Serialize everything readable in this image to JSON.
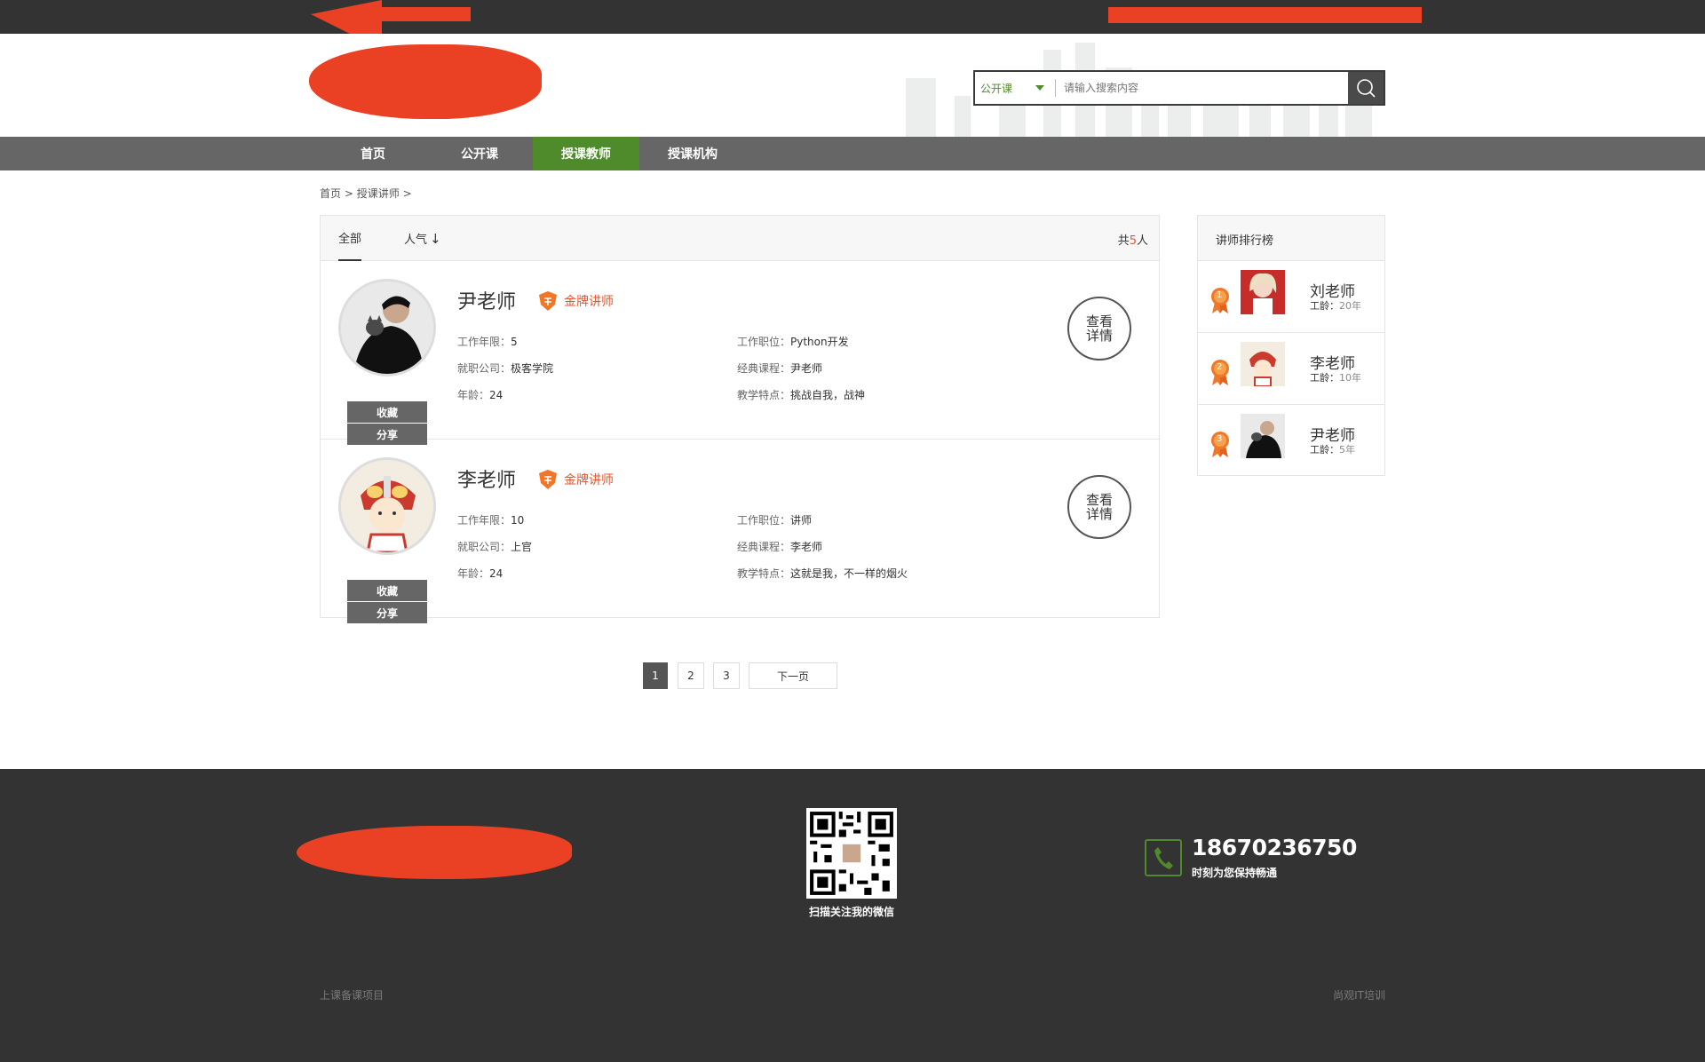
{
  "colors": {
    "accent_green": "#4f8a2b",
    "accent_orange": "#e8532b",
    "nav_bg": "#666666",
    "dark_bg": "#333333"
  },
  "search": {
    "type": "公开课",
    "placeholder": "请输入搜索内容"
  },
  "nav": {
    "items": [
      {
        "label": "首页"
      },
      {
        "label": "公开课"
      },
      {
        "label": "授课教师"
      },
      {
        "label": "授课机构"
      }
    ],
    "active": "授课教师"
  },
  "breadcrumb": {
    "home": "首页",
    "sep": ">",
    "current": "授课讲师"
  },
  "list": {
    "tab_all": "全部",
    "tab_popular": "人气",
    "tab_popular_arrow": "↓",
    "count_prefix": "共",
    "count": "5",
    "count_suffix": "人",
    "teachers": [
      {
        "name": "尹老师",
        "badge": "金牌讲师",
        "years_label": "工作年限：",
        "years": "5",
        "company_label": "就职公司：",
        "company": "极客学院",
        "age_label": "年龄：",
        "age": "24",
        "position_label": "工作职位：",
        "position": "Python开发",
        "course_label": "经典课程：",
        "course": "尹老师",
        "feature_label": "教学特点：",
        "feature": "挑战自我，战神",
        "fav": "收藏",
        "share": "分享",
        "detail": "查看详情"
      },
      {
        "name": "李老师",
        "badge": "金牌讲师",
        "years_label": "工作年限：",
        "years": "10",
        "company_label": "就职公司：",
        "company": "上官",
        "age_label": "年龄：",
        "age": "24",
        "position_label": "工作职位：",
        "position": "讲师",
        "course_label": "经典课程：",
        "course": "李老师",
        "feature_label": "教学特点：",
        "feature": "这就是我，不一样的烟火",
        "fav": "收藏",
        "share": "分享",
        "detail": "查看详情"
      }
    ]
  },
  "pagination": {
    "pages": [
      "1",
      "2",
      "3"
    ],
    "active": "1",
    "next": "下一页"
  },
  "ranking": {
    "title": "讲师排行榜",
    "items": [
      {
        "rank": "1",
        "name": "刘老师",
        "age_label": "工龄：",
        "age": "20年"
      },
      {
        "rank": "2",
        "name": "李老师",
        "age_label": "工龄：",
        "age": "10年"
      },
      {
        "rank": "3",
        "name": "尹老师",
        "age_label": "工龄：",
        "age": "5年"
      }
    ]
  },
  "footer": {
    "qr_caption": "扫描关注我的微信",
    "phone": "18670236750",
    "phone_sub": "时刻为您保持畅通",
    "left_text": "上课备课项目",
    "right_text": "尚观IT培训"
  },
  "icons": [
    "search-icon",
    "shield-badge-icon",
    "medal-icon",
    "phone-icon",
    "qr-code"
  ]
}
